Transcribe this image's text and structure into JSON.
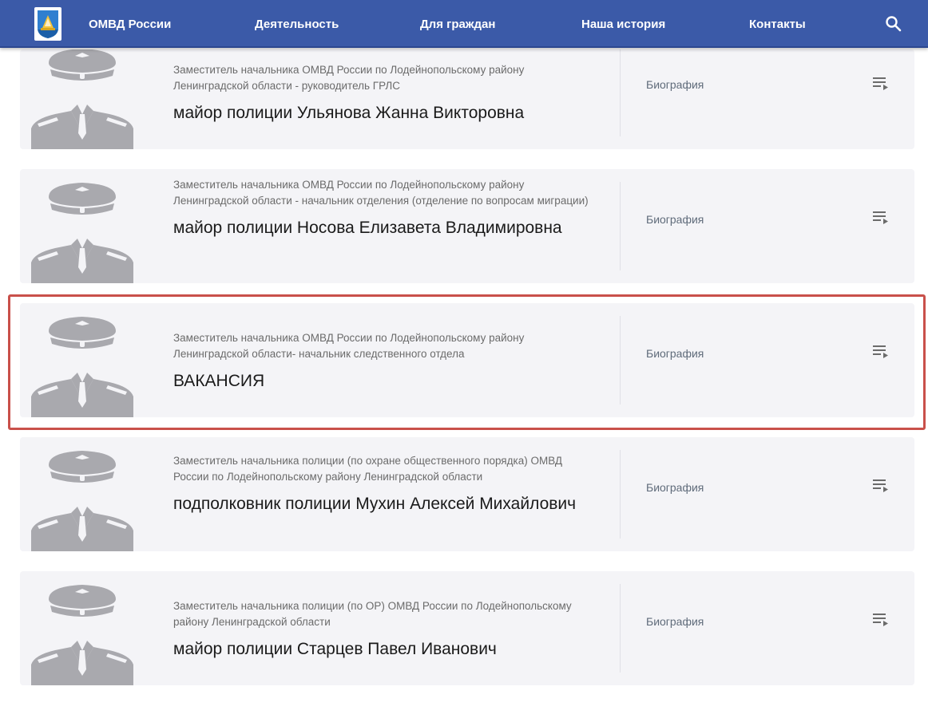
{
  "nav": {
    "items": [
      {
        "label": "ОМВД России",
        "key": "home"
      },
      {
        "label": "Деятельность",
        "key": "activity"
      },
      {
        "label": "Для граждан",
        "key": "citizens"
      },
      {
        "label": "Наша история",
        "key": "history"
      },
      {
        "label": "Контакты",
        "key": "contacts"
      }
    ],
    "logo_icon": "coat-of-arms",
    "search_icon": "search-icon"
  },
  "colors": {
    "navbar": "#3b5aa8",
    "card": "#f4f4f7",
    "highlight": "#c9504a",
    "silhouette": "#a9a9ae"
  },
  "staff": [
    {
      "position": "Заместитель начальника ОМВД России по Лодейнопольскому району Ленинградской области - руководитель ГРЛС",
      "name": "майор полиции Ульянова Жанна Викторовна",
      "bio_label": "Биография"
    },
    {
      "position": "Заместитель начальника ОМВД России по Лодейнопольскому району Ленинградской области - начальник отделения (отделение по вопросам миграции)",
      "name": "майор полиции Носова Елизавета Владимировна",
      "bio_label": "Биография"
    },
    {
      "position": "Заместитель начальника ОМВД России по Лодейнопольскому району Ленинградской области- начальник следственного отдела",
      "name": "ВАКАНСИЯ",
      "bio_label": "Биография",
      "highlighted": true
    },
    {
      "position": "Заместитель начальника полиции (по охране общественного порядка) ОМВД России по Лодейнопольскому району Ленинградской области",
      "name": "подполковник полиции Мухин Алексей Михайлович",
      "bio_label": "Биография"
    },
    {
      "position": "Заместитель начальника полиции (по ОР) ОМВД России по Лодейнопольскому району Ленинградской области",
      "name": "майор полиции Старцев Павел Иванович",
      "bio_label": "Биография"
    }
  ]
}
